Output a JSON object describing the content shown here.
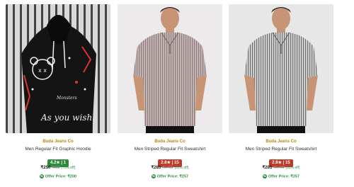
{
  "products": [
    {
      "brand": "Buda Jeans Co",
      "title": "Men Regular Fit Graphic Hoodie",
      "rating": "4.2★ | 1",
      "rating_color": "#2e8b3e",
      "price": "₹250",
      "mrp": "₹999",
      "discount": "(75% off)",
      "offer": "Offer Price: ₹200",
      "image_name": "black-graphic-hoodie"
    },
    {
      "brand": "Buda Jeans Co",
      "title": "Men Striped Regular Fit Sweatshirt",
      "rating": "2.8★ | 15",
      "rating_color": "#c0392b",
      "price": "₹285",
      "mrp": "₹1,499",
      "discount": "(81% off)",
      "offer": "Offer Price: ₹257",
      "image_name": "pink-striped-polo"
    },
    {
      "brand": "Buda Jeans Co",
      "title": "Men Striped Regular Fit Sweatshirt",
      "rating": "2.8★ | 15",
      "rating_color": "#c0392b",
      "price": "₹285",
      "mrp": "₹1,499",
      "discount": "(81% off)",
      "offer": "Offer Price: ₹257",
      "image_name": "grey-striped-polo"
    }
  ]
}
